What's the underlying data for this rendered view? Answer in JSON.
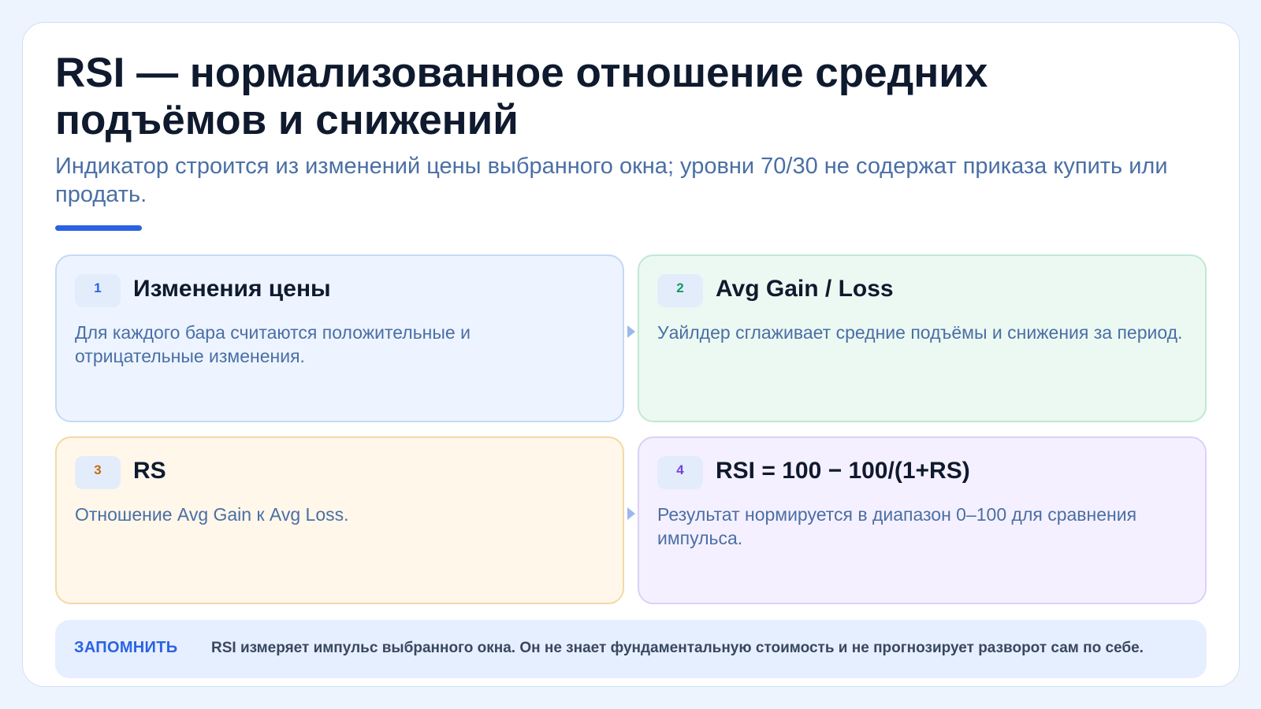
{
  "title": "RSI — нормализованное отношение средних подъёмов и снижений",
  "subtitle": "Индикатор строится из изменений цены выбранного окна; уровни 70/30 не содержат приказа купить или продать.",
  "colors": {
    "accent": "#2b62e3",
    "step1": "#2b62e3",
    "step2": "#119b63",
    "step3": "#c86a12",
    "step4": "#7a3fe0",
    "arrow": "#9db8ea"
  },
  "steps": [
    {
      "num": "1",
      "title": "Изменения цены",
      "body": "Для каждого бара считаются положительные и отрицательные изменения."
    },
    {
      "num": "2",
      "title": "Avg Gain / Loss",
      "body": "Уайлдер сглаживает средние подъёмы и снижения за период."
    },
    {
      "num": "3",
      "title": "RS",
      "body": "Отношение Avg Gain к Avg Loss."
    },
    {
      "num": "4",
      "title": "RSI = 100 − 100/(1+RS)",
      "body": "Результат нормируется в диапазон 0–100 для сравнения импульса."
    }
  ],
  "arrows": [
    "arrow-right-icon",
    "arrow-right-icon"
  ],
  "note": {
    "label": "ЗАПОМНИТЬ",
    "text": "RSI измеряет импульс выбранного окна. Он не знает фундаментальную стоимость и не прогнозирует разворот сам по себе."
  }
}
